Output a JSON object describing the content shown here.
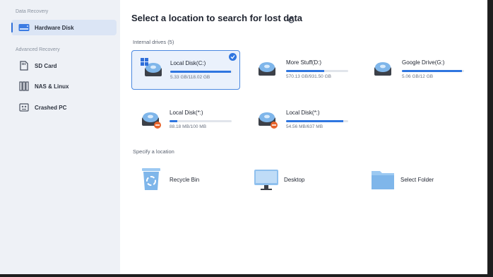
{
  "sidebar": {
    "section_data_recovery": "Data Recovery",
    "section_advanced": "Advanced Recovery",
    "items": [
      {
        "label": "Hardware Disk",
        "icon": "hard-disk-icon",
        "active": true
      },
      {
        "label": "SD Card",
        "icon": "sd-card-icon"
      },
      {
        "label": "NAS & Linux",
        "icon": "nas-icon"
      },
      {
        "label": "Crashed PC",
        "icon": "crashed-pc-icon"
      }
    ]
  },
  "main": {
    "title": "Select a location to search for lost data",
    "internal_label": "Internal drives (5)",
    "specify_label": "Specify a location",
    "drives": [
      {
        "name": "Local Disk(C:)",
        "size": "5.33 GB/118.02 GB",
        "used_fraction": 0.98,
        "selected": true,
        "windows": true
      },
      {
        "name": "More Stuff(D:)",
        "size": "570.13 GB/931.50 GB",
        "used_fraction": 0.61
      },
      {
        "name": "Google Drive(G:)",
        "size": "5.06 GB/12 GB",
        "used_fraction": 0.97
      },
      {
        "name": "Local Disk(*:)",
        "size": "88.18 MB/100 MB",
        "used_fraction": 0.12,
        "warning": true
      },
      {
        "name": "Local Disk(*:)",
        "size": "54.56 MB/637 MB",
        "used_fraction": 0.92,
        "warning": true
      }
    ],
    "locations": [
      {
        "name": "Recycle Bin",
        "icon": "recycle-bin-icon"
      },
      {
        "name": "Desktop",
        "icon": "desktop-icon"
      },
      {
        "name": "Select Folder",
        "icon": "folder-icon"
      }
    ]
  },
  "colors": {
    "accent": "#2f76e0",
    "sidebar_bg": "#eef1f6",
    "warning": "#e8642c"
  }
}
